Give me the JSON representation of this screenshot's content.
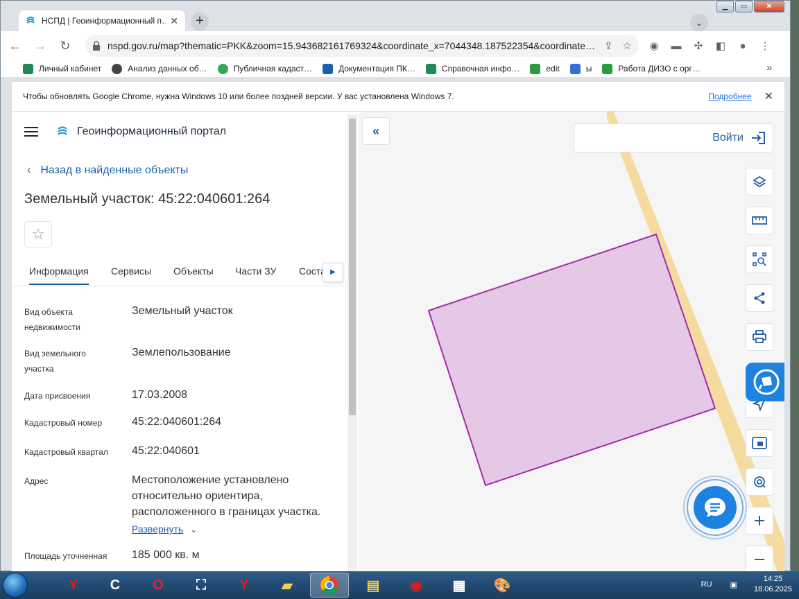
{
  "browser": {
    "tab_title": "НСПД | Геоинформационный п…",
    "url": "nspd.gov.ru/map?thematic=PKK&zoom=15.943682161769324&coordinate_x=7044348.187522354&coordinate…",
    "bookmarks": [
      "Личный кабинет",
      "Анализ данных об…",
      "Публичная кадаст…",
      "Документация ПК…",
      "Справочная инфо…",
      "edit",
      "ы",
      "Работа ДИЗО с орг…"
    ],
    "infobar_message": "Чтобы обновлять Google Chrome, нужна Windows 10 или более поздней версии. У вас установлена Windows 7.",
    "infobar_link": "Подробнее"
  },
  "portal": {
    "title": "Геоинформационный портал",
    "back_label": "Назад в найденные объекты",
    "object_title": "Земельный участок: 45:22:040601:264",
    "tabs": [
      "Информация",
      "Сервисы",
      "Объекты",
      "Части ЗУ",
      "Соста…"
    ],
    "fields": [
      {
        "label": "Вид объекта недвижимости",
        "value": "Земельный участок"
      },
      {
        "label": "Вид земельного участка",
        "value": "Землепользование"
      },
      {
        "label": "Дата присвоения",
        "value": "17.03.2008"
      },
      {
        "label": "Кадастровый номер",
        "value": "45:22:040601:264"
      },
      {
        "label": "Кадастровый квартал",
        "value": "45:22:040601"
      },
      {
        "label": "Адрес",
        "value": "Местоположение установлено относительно ориентира, расположенного в границах участка."
      },
      {
        "label": "Площадь уточненная",
        "value": "185 000 кв. м"
      }
    ],
    "expand_label": "Развернуть"
  },
  "map": {
    "login_label": "Войти",
    "parcel_fill": "#e5c8e5",
    "parcel_stroke": "#a22aa8",
    "road_color": "#f5dba0"
  },
  "taskbar": {
    "lang": "RU",
    "time": "14:25",
    "date": "18.06.2025"
  }
}
